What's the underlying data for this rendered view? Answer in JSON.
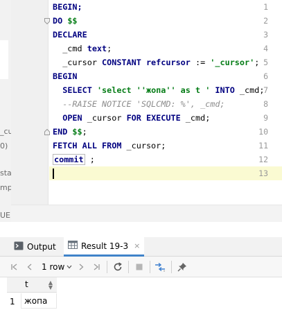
{
  "left_fragments": [
    "_cu",
    "0)",
    "sta",
    "mp",
    "UE"
  ],
  "editor": {
    "line_numbers": [
      "1",
      "2",
      "3",
      "4",
      "5",
      "6",
      "7",
      "8",
      "9",
      "10",
      "11",
      "12",
      "13"
    ],
    "lines": [
      {
        "segments": [
          {
            "t": "BEGIN;",
            "c": "kw"
          }
        ]
      },
      {
        "segments": [
          {
            "t": "DO ",
            "c": "kw"
          },
          {
            "t": "$$",
            "c": "dollar"
          }
        ]
      },
      {
        "segments": [
          {
            "t": "DECLARE",
            "c": "kw"
          }
        ]
      },
      {
        "segments": [
          {
            "t": "  _cmd ",
            "c": ""
          },
          {
            "t": "text",
            "c": "kw"
          },
          {
            "t": ";",
            "c": ""
          }
        ]
      },
      {
        "segments": [
          {
            "t": "  _cursor ",
            "c": ""
          },
          {
            "t": "CONSTANT ",
            "c": "kw"
          },
          {
            "t": "refcursor ",
            "c": "kw"
          },
          {
            "t": ":= ",
            "c": ""
          },
          {
            "t": "'_cursor'",
            "c": "str"
          },
          {
            "t": ";",
            "c": ""
          }
        ]
      },
      {
        "segments": [
          {
            "t": "BEGIN",
            "c": "kw"
          }
        ]
      },
      {
        "segments": [
          {
            "t": "  ",
            "c": ""
          },
          {
            "t": "SELECT ",
            "c": "kw"
          },
          {
            "t": "'select ''жопа'' as t '",
            "c": "str"
          },
          {
            "t": " ",
            "c": ""
          },
          {
            "t": "INTO ",
            "c": "kw"
          },
          {
            "t": "_cmd;",
            "c": ""
          }
        ]
      },
      {
        "segments": [
          {
            "t": "  --RAISE NOTICE 'SQLCMD: %', _cmd;",
            "c": "cmt"
          }
        ]
      },
      {
        "segments": [
          {
            "t": "  ",
            "c": ""
          },
          {
            "t": "OPEN ",
            "c": "kw"
          },
          {
            "t": "_cursor ",
            "c": ""
          },
          {
            "t": "FOR EXECUTE ",
            "c": "kw"
          },
          {
            "t": "_cmd;",
            "c": ""
          }
        ]
      },
      {
        "segments": [
          {
            "t": "END ",
            "c": "kw"
          },
          {
            "t": "$$",
            "c": "dollar"
          },
          {
            "t": ";",
            "c": ""
          }
        ]
      },
      {
        "segments": [
          {
            "t": "FETCH ALL FROM ",
            "c": "kw"
          },
          {
            "t": "_cursor;",
            "c": ""
          }
        ]
      },
      {
        "segments": [
          {
            "t": "commit",
            "c": "kw commit-box"
          },
          {
            "t": " ;",
            "c": ""
          }
        ]
      },
      {
        "segments": []
      }
    ]
  },
  "tool_window": {
    "tabs": [
      {
        "label": "Output",
        "icon": "console-icon"
      },
      {
        "label": "Result 19-3",
        "icon": "table-icon",
        "close": "×"
      }
    ],
    "toolbar": {
      "rows_label": "1 row",
      "buttons": [
        "first-page-icon",
        "prev-page-icon",
        "next-page-icon",
        "last-page-icon",
        "refresh-icon",
        "stop-icon",
        "compare-icon",
        "pin-icon"
      ]
    },
    "grid": {
      "columns": [
        "t"
      ],
      "rows": [
        {
          "num": "1",
          "values": [
            "жопа"
          ]
        }
      ]
    }
  },
  "colors": {
    "accent": "#4083c9",
    "keyword": "#000080",
    "string": "#067d17",
    "comment": "#8c8c8c",
    "current_line": "#fafad2"
  }
}
